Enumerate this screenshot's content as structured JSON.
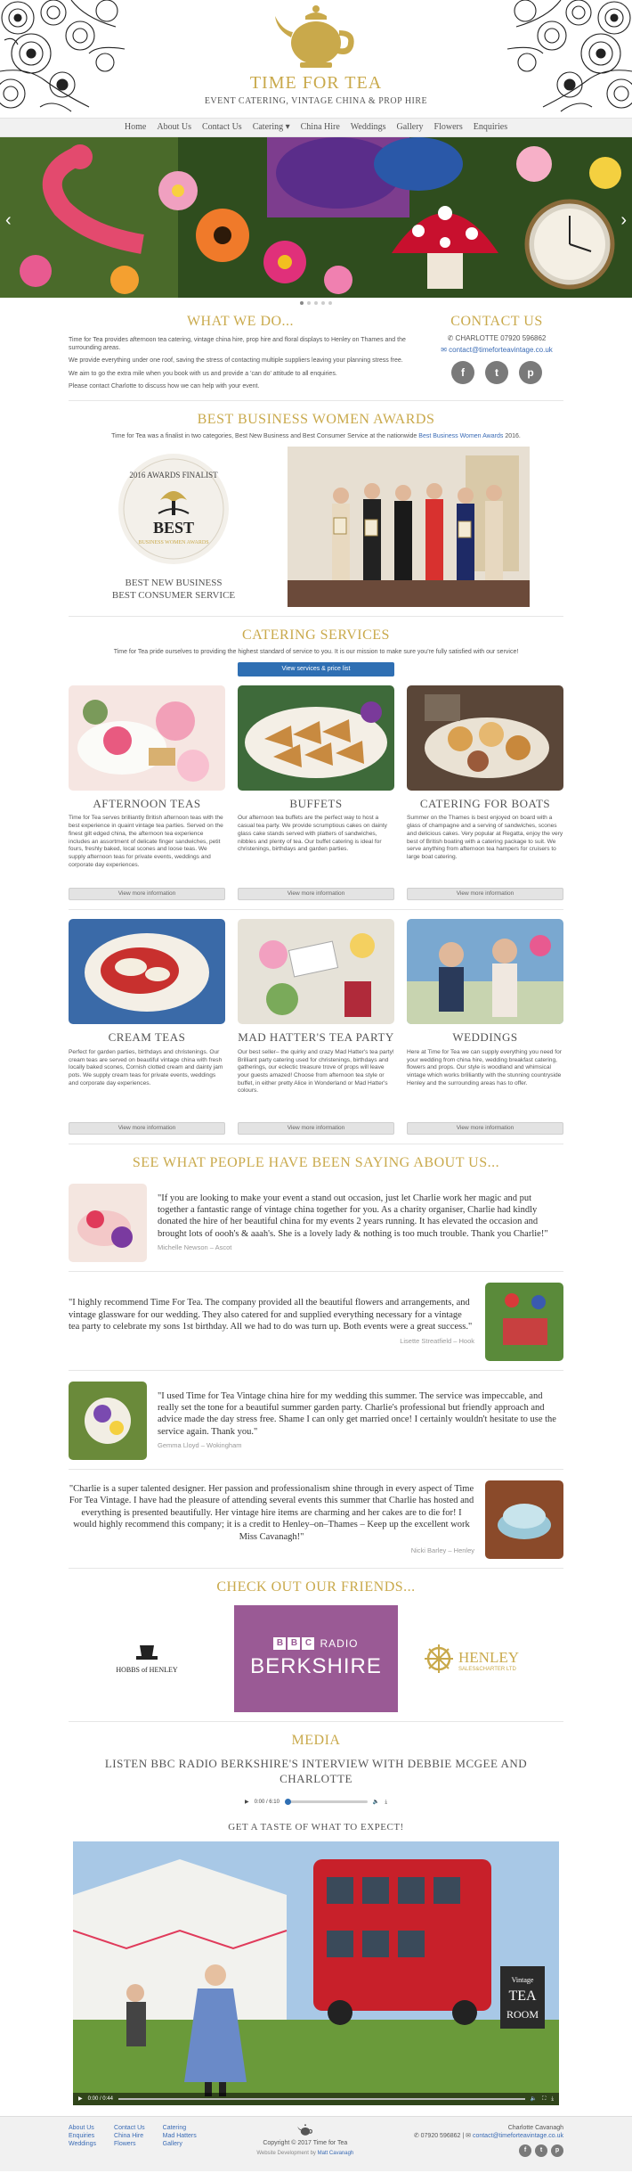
{
  "site": {
    "title": "TIME FOR TEA",
    "subtitle": "EVENT CATERING, VINTAGE CHINA & PROP HIRE"
  },
  "nav": [
    "Home",
    "About Us",
    "Contact Us",
    "Catering ▾",
    "China Hire",
    "Weddings",
    "Gallery",
    "Flowers",
    "Enquiries"
  ],
  "hero": {
    "prev_icon": "chevron-left-icon",
    "next_icon": "chevron-right-icon"
  },
  "what_we_do": {
    "heading": "WHAT WE DO...",
    "paragraphs": [
      "Time for Tea provides afternoon tea catering, vintage china hire, prop hire and floral displays to Henley on Thames and the surrounding areas.",
      "We provide everything under one roof, saving the stress of contacting multiple suppliers leaving your planning stress free.",
      "We aim to go the extra mile when you book with us and provide a 'can do' attitude to all enquiries.",
      "Please contact Charlotte to discuss how we can help with your event."
    ]
  },
  "contact": {
    "heading": "CONTACT US",
    "phone": "CHARLOTTE 07920 596862",
    "email": "contact@timefortеavintage.co.uk",
    "socials": [
      "f",
      "t",
      "p"
    ]
  },
  "awards": {
    "heading": "BEST BUSINESS WOMEN AWARDS",
    "intro": "Time for Tea was a finalist in two categories, Best New Business and Best Consumer Service at the nationwide",
    "link": "Best Business Women Awards",
    "intro_end": "2016.",
    "badge_top": "2016 AWARDS FINALIST",
    "badge_word": "BEST",
    "badge_bottom": "BUSINESS WOMEN AWARDS",
    "caption_1": "BEST NEW BUSINESS",
    "caption_2": "BEST CONSUMER SERVICE"
  },
  "catering": {
    "heading": "CATERING SERVICES",
    "intro": "Time for Tea pride ourselves to providing the highest standard of service to you. It is our mission to make sure you're fully satisfied with our service!",
    "button": "View services & price list",
    "more": "View more information",
    "cards": [
      {
        "title": "AFTERNOON TEAS",
        "text": "Time for Tea serves brilliantly British afternoon teas with the best experience in quaint vintage tea parties. Served on the finest gilt edged china, the afternoon tea experience includes an assortment of delicate finger sandwiches, petit fours, freshly baked, local scones and loose teas. We supply afternoon teas for private events, weddings and corporate day experiences."
      },
      {
        "title": "BUFFETS",
        "text": "Our afternoon tea buffets are the perfect way to host a casual tea party. We provide scrumptious cakes on dainty glass cake stands served with platters of sandwiches, nibbles and plenty of tea. Our buffet catering is ideal for christenings, birthdays and garden parties."
      },
      {
        "title": "CATERING FOR BOATS",
        "text": "Summer on the Thames is best enjoyed on board with a glass of champagne and a serving of sandwiches, scones and delicious cakes. Very popular at Regatta, enjoy the very best of British boating with a catering package to suit. We serve anything from afternoon tea hampers for cruisers to large boat catering."
      },
      {
        "title": "CREAM TEAS",
        "text": "Perfect for garden parties, birthdays and christenings. Our cream teas are served on beautiful vintage china with fresh locally baked scones, Cornish clotted cream and dainty jam pots. We supply cream teas for private events, weddings and corporate day experiences."
      },
      {
        "title": "MAD HATTER'S TEA PARTY",
        "text": "Our best seller– the quirky and crazy Mad Hatter's tea party! Brilliant party catering used for christenings, birthdays and gatherings, our eclectic treasure trove of props will leave your guests amazed! Choose from afternoon tea style or buffet, in either pretty Alice in Wonderland or Mad Hatter's colours."
      },
      {
        "title": "WEDDINGS",
        "text": "Here at Time for Tea we can supply everything you need for your wedding from china hire, wedding breakfast catering, flowers and props. Our style is woodland and whimsical vintage which works brilliantly with the stunning countryside Henley and the surrounding areas has to offer."
      }
    ]
  },
  "testimonials": {
    "heading": "SEE WHAT PEOPLE HAVE BEEN SAYING ABOUT US...",
    "items": [
      {
        "quote": "\"If you are looking to make your event a stand out occasion, just let Charlie work her magic and put together a fantastic range of vintage china together for you. As a charity organiser, Charlie had kindly donated the hire of her beautiful china for my events 2 years running. It has elevated the occasion and brought lots of oooh's & aaah's. She is a lovely lady & nothing is too much trouble. Thank you Charlie!\"",
        "author": "Michelle Newson – Ascot"
      },
      {
        "quote": "\"I highly recommend Time For Tea. The company provided all the beautiful flowers and arrangements, and vintage glassware for our wedding. They also catered for and supplied everything necessary for a vintage tea party to celebrate my sons 1st birthday. All we had to do was turn up. Both events were a great success.\"",
        "author": "Lisette Streatfield – Hook"
      },
      {
        "quote": "\"I used Time for Tea Vintage china hire for my wedding this summer. The service was impeccable, and really set the tone for a beautiful summer garden party. Charlie's professional but friendly approach and advice made the day stress free. Shame I can only get married once! I certainly wouldn't hesitate to use the service again. Thank you.\"",
        "author": "Gemma Lloyd – Wokingham"
      },
      {
        "quote": "\"Charlie is a super talented designer. Her passion and professionalism shine through in every aspect of Time For Tea Vintage. I have had the pleasure of attending several events this summer that Charlie has hosted and everything is presented beautifully. Her vintage hire items are charming and her cakes are to die for! I would highly recommend this company; it is a credit to Henley–on–Thames – Keep up the excellent work Miss Cavanagh!\"",
        "author": "Nicki Barley – Henley"
      }
    ]
  },
  "friends": {
    "heading": "CHECK OUT OUR FRIENDS...",
    "hobbs": "HOBBS of HENLEY",
    "bbc_letters": [
      "B",
      "B",
      "C"
    ],
    "bbc_radio": "RADIO",
    "bbc_station": "BERKSHIRE",
    "henley": "HENLEY",
    "henley_sub": "SALES&CHARTER LTD"
  },
  "media": {
    "heading": "MEDIA",
    "subheading": "LISTEN BBC RADIO BERKSHIRE'S INTERVIEW WITH DEBBIE MCGEE AND CHARLOTTE",
    "audio_time": "0:00 / 6:10",
    "taste": "GET A TASTE OF WHAT TO EXPECT!",
    "video_time": "0:00 / 0:44",
    "video_sign_1": "Vintage",
    "video_sign_2": "TEA",
    "video_sign_3": "ROOM"
  },
  "footer": {
    "col1": [
      "About Us",
      "Enquiries",
      "Weddings"
    ],
    "col2": [
      "Contact Us",
      "China Hire",
      "Flowers"
    ],
    "col3": [
      "Catering",
      "Mad Hatters",
      "Gallery"
    ],
    "copyright": "Copyright © 2017 Time for Tea",
    "dev_label": "Website Development by",
    "dev_name": "Matt Cavanagh",
    "name": "Charlotte Cavanagh",
    "phone": "07920 596862",
    "email": "contact@timefortеavintage.co.uk",
    "socials": [
      "f",
      "t",
      "p"
    ]
  },
  "colors": {
    "gold": "#c9a94b",
    "link": "#3a6bb5",
    "button_blue": "#2f6fb3",
    "bbc_purple": "#9a5a95"
  }
}
